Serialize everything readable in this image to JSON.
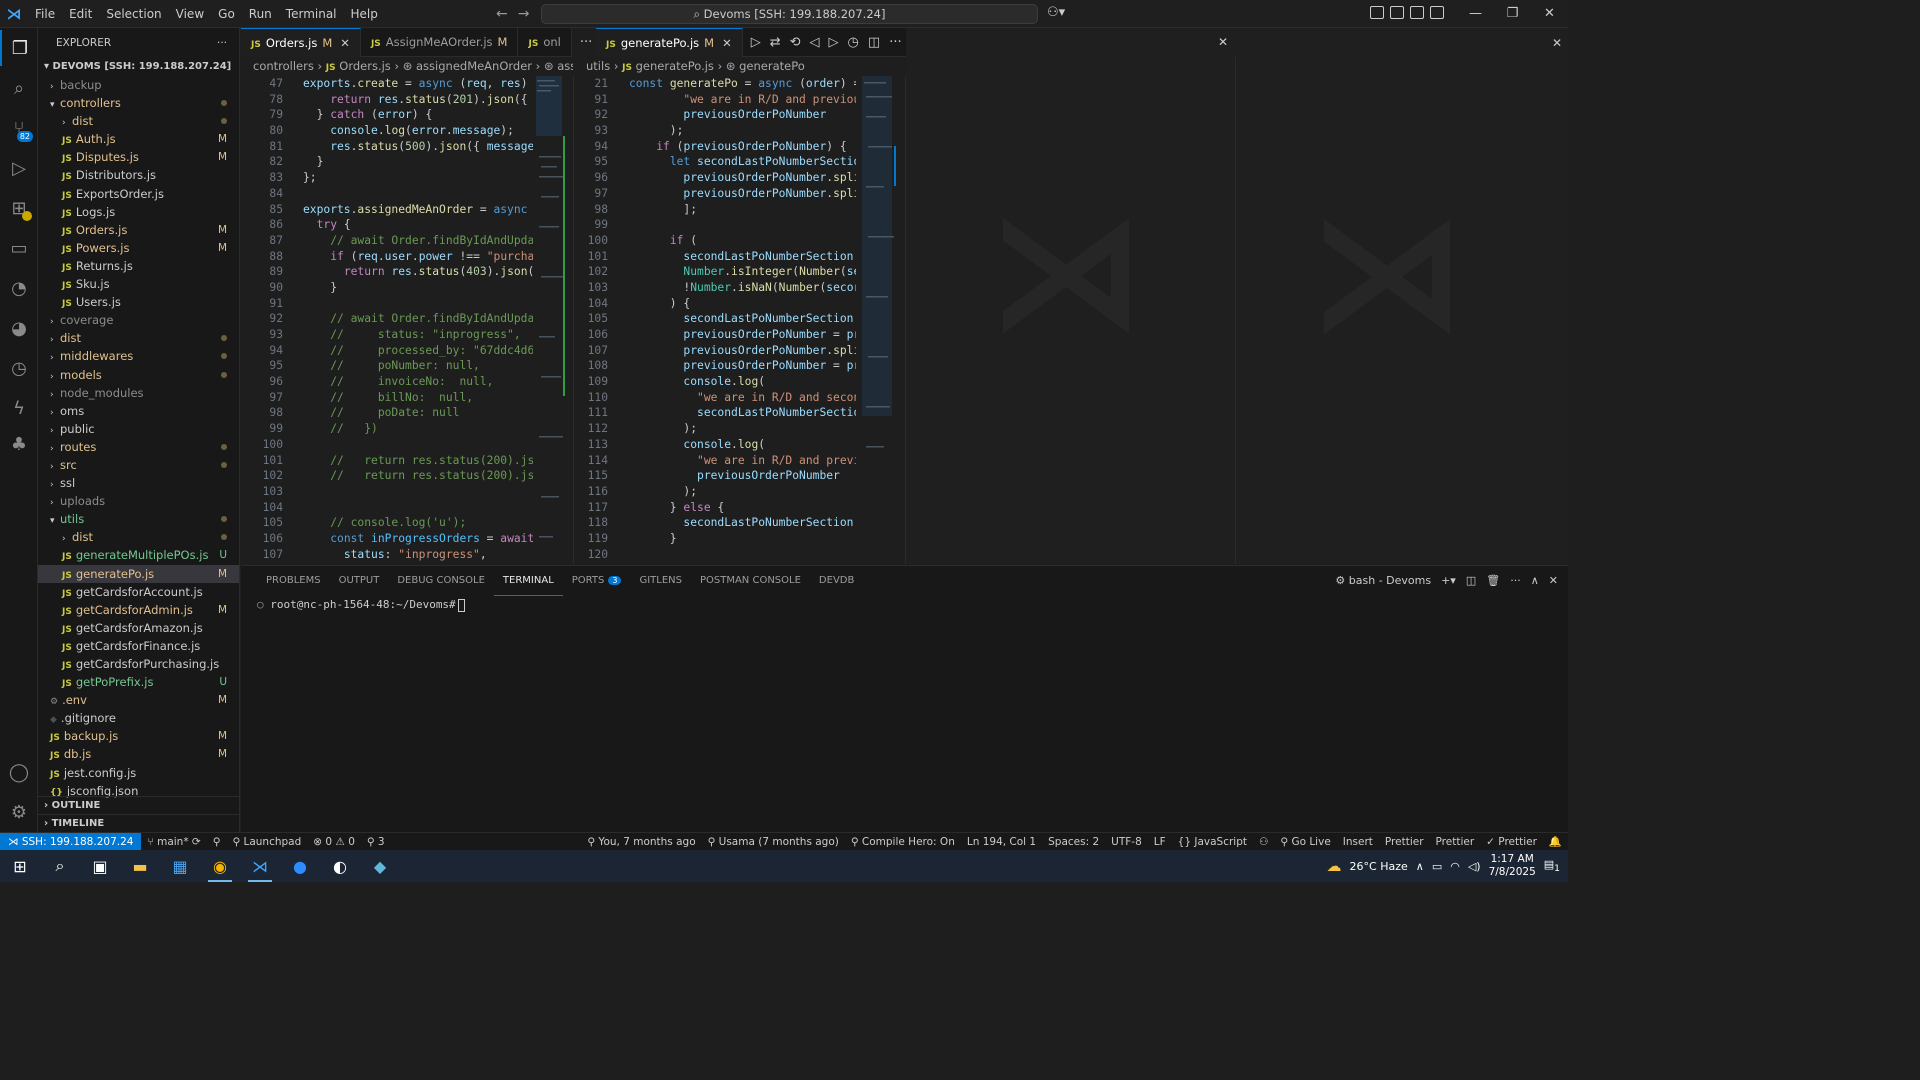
{
  "menu": [
    "File",
    "Edit",
    "Selection",
    "View",
    "Go",
    "Run",
    "Terminal",
    "Help"
  ],
  "search": "Devoms [SSH: 199.188.207.24]",
  "explorer": {
    "title": "EXPLORER",
    "root": "DEVOMS [SSH: 199.188.207.24]",
    "items": [
      {
        "label": "backup",
        "indent": 1,
        "type": "folder",
        "open": false,
        "state": "dim"
      },
      {
        "label": "controllers",
        "indent": 1,
        "type": "folder",
        "open": true,
        "state": "mod",
        "dot": true
      },
      {
        "label": "dist",
        "indent": 2,
        "type": "folder",
        "open": false,
        "state": "mod",
        "dot": true
      },
      {
        "label": "Auth.js",
        "indent": 2,
        "type": "js",
        "state": "mod",
        "status": "M"
      },
      {
        "label": "Disputes.js",
        "indent": 2,
        "type": "js",
        "state": "mod",
        "status": "M"
      },
      {
        "label": "Distributors.js",
        "indent": 2,
        "type": "js",
        "state": ""
      },
      {
        "label": "ExportsOrder.js",
        "indent": 2,
        "type": "js",
        "state": ""
      },
      {
        "label": "Logs.js",
        "indent": 2,
        "type": "js",
        "state": ""
      },
      {
        "label": "Orders.js",
        "indent": 2,
        "type": "js",
        "state": "mod",
        "status": "M"
      },
      {
        "label": "Powers.js",
        "indent": 2,
        "type": "js",
        "state": "mod",
        "status": "M"
      },
      {
        "label": "Returns.js",
        "indent": 2,
        "type": "js",
        "state": ""
      },
      {
        "label": "Sku.js",
        "indent": 2,
        "type": "js",
        "state": ""
      },
      {
        "label": "Users.js",
        "indent": 2,
        "type": "js",
        "state": ""
      },
      {
        "label": "coverage",
        "indent": 1,
        "type": "folder",
        "open": false,
        "state": "dim"
      },
      {
        "label": "dist",
        "indent": 1,
        "type": "folder",
        "open": false,
        "state": "mod",
        "dot": true
      },
      {
        "label": "middlewares",
        "indent": 1,
        "type": "folder",
        "open": false,
        "state": "mod",
        "dot": true
      },
      {
        "label": "models",
        "indent": 1,
        "type": "folder",
        "open": false,
        "state": "mod",
        "dot": true
      },
      {
        "label": "node_modules",
        "indent": 1,
        "type": "folder",
        "open": false,
        "state": "dim"
      },
      {
        "label": "oms",
        "indent": 1,
        "type": "folder",
        "open": false,
        "state": ""
      },
      {
        "label": "public",
        "indent": 1,
        "type": "folder",
        "open": false,
        "state": ""
      },
      {
        "label": "routes",
        "indent": 1,
        "type": "folder",
        "open": false,
        "state": "mod",
        "dot": true
      },
      {
        "label": "src",
        "indent": 1,
        "type": "folder",
        "open": false,
        "state": "mod",
        "dot": true
      },
      {
        "label": "ssl",
        "indent": 1,
        "type": "folder",
        "open": false,
        "state": ""
      },
      {
        "label": "uploads",
        "indent": 1,
        "type": "folder",
        "open": false,
        "state": "dim"
      },
      {
        "label": "utils",
        "indent": 1,
        "type": "folder",
        "open": true,
        "state": "new",
        "dot": true
      },
      {
        "label": "dist",
        "indent": 2,
        "type": "folder",
        "open": false,
        "state": "mod",
        "dot": true
      },
      {
        "label": "generateMultiplePOs.js",
        "indent": 2,
        "type": "js",
        "state": "new",
        "status": "U"
      },
      {
        "label": "generatePo.js",
        "indent": 2,
        "type": "js",
        "state": "mod",
        "status": "M",
        "selected": true
      },
      {
        "label": "getCardsforAccount.js",
        "indent": 2,
        "type": "js",
        "state": ""
      },
      {
        "label": "getCardsforAdmin.js",
        "indent": 2,
        "type": "js",
        "state": "mod",
        "status": "M"
      },
      {
        "label": "getCardsforAmazon.js",
        "indent": 2,
        "type": "js",
        "state": ""
      },
      {
        "label": "getCardsforFinance.js",
        "indent": 2,
        "type": "js",
        "state": ""
      },
      {
        "label": "getCardsforPurchasing.js",
        "indent": 2,
        "type": "js",
        "state": ""
      },
      {
        "label": "getPoPrefix.js",
        "indent": 2,
        "type": "js",
        "state": "new",
        "status": "U"
      },
      {
        "label": ".env",
        "indent": 1,
        "type": "gear",
        "state": "mod",
        "status": "M"
      },
      {
        "label": ".gitignore",
        "indent": 1,
        "type": "git",
        "state": ""
      },
      {
        "label": "backup.js",
        "indent": 1,
        "type": "js",
        "state": "mod",
        "status": "M"
      },
      {
        "label": "db.js",
        "indent": 1,
        "type": "js",
        "state": "mod",
        "status": "M"
      },
      {
        "label": "jest.config.js",
        "indent": 1,
        "type": "js",
        "state": ""
      },
      {
        "label": "jsconfig.json",
        "indent": 1,
        "type": "json",
        "state": ""
      }
    ],
    "outline": "OUTLINE",
    "timeline": "TIMELINE"
  },
  "left_tabs": [
    {
      "label": "Orders.js",
      "mod": "M",
      "active": true
    },
    {
      "label": "AssignMeAOrder.js",
      "mod": "M",
      "active": false
    },
    {
      "label": "onl",
      "mod": "",
      "active": false
    }
  ],
  "right_tabs": [
    {
      "label": "generatePo.js",
      "mod": "M",
      "active": true
    }
  ],
  "left_crumb": {
    "a": "controllers",
    "b": "Orders.js",
    "c": "assignedMeAnOrder",
    "d": "assigned"
  },
  "right_crumb": {
    "a": "utils",
    "b": "generatePo.js",
    "c": "generatePo"
  },
  "left_code": [
    {
      "n": "47",
      "h": "<span class='v'>exports</span>.<span class='f'>create</span> = <span class='k'>async</span> (<span class='v'>req</span>, <span class='v'>res</span>) =>"
    },
    {
      "n": "78",
      "h": "    <span class='c'>return</span> <span class='v'>res</span>.<span class='f'>status</span>(<span class='n'>201</span>).<span class='f'>json</span>({ <span class='v'>m</span>"
    },
    {
      "n": "79",
      "h": "  } <span class='c'>catch</span> (<span class='v'>error</span>) {"
    },
    {
      "n": "80",
      "h": "    <span class='v'>console</span>.<span class='f'>log</span>(<span class='v'>error</span>.<span class='v'>message</span>);"
    },
    {
      "n": "81",
      "h": "    <span class='v'>res</span>.<span class='f'>status</span>(<span class='n'>500</span>).<span class='f'>json</span>({ <span class='v'>message</span>:"
    },
    {
      "n": "82",
      "h": "  }"
    },
    {
      "n": "83",
      "h": "};"
    },
    {
      "n": "84",
      "h": ""
    },
    {
      "n": "85",
      "h": "<span class='v'>exports</span>.<span class='f'>assignedMeAnOrder</span> = <span class='k'>async</span> (<span class='v'>r</span>"
    },
    {
      "n": "86",
      "h": "  <span class='c'>try</span> {"
    },
    {
      "n": "87",
      "h": "    <span class='cm'>// await Order.findByIdAndUpdate</span>"
    },
    {
      "n": "88",
      "h": "    <span class='c'>if</span> (<span class='v'>req</span>.<span class='v'>user</span>.<span class='v'>power</span> !== <span class='s'>\"purchas</span>"
    },
    {
      "n": "89",
      "h": "      <span class='c'>return</span> <span class='v'>res</span>.<span class='f'>status</span>(<span class='n'>403</span>).<span class='f'>json</span>({"
    },
    {
      "n": "90",
      "h": "    }"
    },
    {
      "n": "91",
      "h": ""
    },
    {
      "n": "92",
      "h": "    <span class='cm'>// await Order.findByIdAndUpdate</span>"
    },
    {
      "n": "93",
      "h": "    <span class='cm'>//     status: \"inprogress\",</span>"
    },
    {
      "n": "94",
      "h": "    <span class='cm'>//     processed_by: \"67ddc4d60</span>"
    },
    {
      "n": "95",
      "h": "    <span class='cm'>//     poNumber: null,</span>"
    },
    {
      "n": "96",
      "h": "    <span class='cm'>//     invoiceNo:  null,</span>"
    },
    {
      "n": "97",
      "h": "    <span class='cm'>//     billNo:  null,</span>"
    },
    {
      "n": "98",
      "h": "    <span class='cm'>//     poDate: null</span>"
    },
    {
      "n": "99",
      "h": "    <span class='cm'>//   })</span>"
    },
    {
      "n": "100",
      "h": ""
    },
    {
      "n": "101",
      "h": "    <span class='cm'>//   return res.status(200).json</span>"
    },
    {
      "n": "102",
      "h": "    <span class='cm'>//   return res.status(200).json</span>"
    },
    {
      "n": "103",
      "h": ""
    },
    {
      "n": "104",
      "h": ""
    },
    {
      "n": "105",
      "h": "    <span class='cm'>// console.log('u');</span>"
    },
    {
      "n": "106",
      "h": "    <span class='k'>const</span> <span class='cv'>inProgressOrders</span> = <span class='c'>await</span> (<span class='t'>O</span>"
    },
    {
      "n": "107",
      "h": "      <span class='v'>status</span>: <span class='s'>\"inprogress\"</span>,"
    }
  ],
  "right_code": [
    {
      "n": "21",
      "h": "<span class='k'>const</span> <span class='f'>generatePo</span> = <span class='k'>async</span> (<span class='v'>order</span>) =>"
    },
    {
      "n": "91",
      "h": "        <span class='s'>\"we are in R/D and previous</span>"
    },
    {
      "n": "92",
      "h": "        <span class='v'>previousOrderPoNumber</span>"
    },
    {
      "n": "93",
      "h": "      );"
    },
    {
      "n": "94",
      "h": "    <span class='c'>if</span> (<span class='v'>previousOrderPoNumber</span>) {"
    },
    {
      "n": "95",
      "h": "      <span class='k'>let</span> <span class='v'>secondLastPoNumberSectio</span>"
    },
    {
      "n": "96",
      "h": "        <span class='v'>previousOrderPoNumber</span>.<span class='f'>spli</span>"
    },
    {
      "n": "97",
      "h": "        <span class='v'>previousOrderPoNumber</span>.<span class='f'>spli</span>"
    },
    {
      "n": "98",
      "h": "        ];"
    },
    {
      "n": "99",
      "h": ""
    },
    {
      "n": "100",
      "h": "      <span class='c'>if</span> ("
    },
    {
      "n": "101",
      "h": "        <span class='v'>secondLastPoNumberSection</span>."
    },
    {
      "n": "102",
      "h": "        <span class='t'>Number</span>.<span class='f'>isInteger</span>(<span class='f'>Number</span>(<span class='v'>se</span>"
    },
    {
      "n": "103",
      "h": "        !<span class='t'>Number</span>.<span class='f'>isNaN</span>(<span class='f'>Number</span>(<span class='v'>secor</span>"
    },
    {
      "n": "104",
      "h": "      ) {"
    },
    {
      "n": "105",
      "h": "        <span class='v'>secondLastPoNumberSection</span> ="
    },
    {
      "n": "106",
      "h": "        <span class='v'>previousOrderPoNumber</span> = <span class='v'>pr</span>"
    },
    {
      "n": "107",
      "h": "        <span class='v'>previousOrderPoNumber</span>.<span class='f'>spli</span>"
    },
    {
      "n": "108",
      "h": "        <span class='v'>previousOrderPoNumber</span> = <span class='v'>pr</span>"
    },
    {
      "n": "109",
      "h": "        <span class='v'>console</span>.<span class='f'>log</span>("
    },
    {
      "n": "110",
      "h": "          <span class='s'>\"we are in R/D and secon</span>"
    },
    {
      "n": "111",
      "h": "          <span class='v'>secondLastPoNumberSectio</span>"
    },
    {
      "n": "112",
      "h": "        );"
    },
    {
      "n": "113",
      "h": "        <span class='v'>console</span>.<span class='f'>log</span>("
    },
    {
      "n": "114",
      "h": "          <span class='s'>\"we are in R/D and previ</span>"
    },
    {
      "n": "115",
      "h": "          <span class='v'>previousOrderPoNumber</span>"
    },
    {
      "n": "116",
      "h": "        );"
    },
    {
      "n": "117",
      "h": "      } <span class='c'>else</span> {"
    },
    {
      "n": "118",
      "h": "        <span class='v'>secondLastPoNumberSection</span>"
    },
    {
      "n": "119",
      "h": "      }"
    },
    {
      "n": "120",
      "h": ""
    }
  ],
  "panel": {
    "tabs": [
      "PROBLEMS",
      "OUTPUT",
      "DEBUG CONSOLE",
      "TERMINAL",
      "PORTS",
      "GITLENS",
      "POSTMAN CONSOLE",
      "DEVDB"
    ],
    "active": "TERMINAL",
    "ports_badge": "3",
    "shell": "bash - Devoms",
    "prompt": "root@nc-ph-1564-48:~/Devoms#"
  },
  "status": {
    "remote": "SSH: 199.188.207.24",
    "branch": "main*",
    "launchpad": "Launchpad",
    "errors": "0",
    "warnings": "0",
    "ports": "3",
    "blame": "You, 7 months ago",
    "author": "Usama (7 months ago)",
    "compile": "Compile Hero: On",
    "position": "Ln 194, Col 1",
    "spaces": "Spaces: 2",
    "encoding": "UTF-8",
    "eol": "LF",
    "language": "JavaScript",
    "golive": "Go Live",
    "insert": "Insert",
    "prettier1": "Prettier",
    "prettier2": "Prettier",
    "prettier3": "Prettier"
  },
  "taskbar": {
    "weather": "26°C  Haze",
    "time": "1:17 AM",
    "date": "7/8/2025",
    "notif": "1"
  }
}
